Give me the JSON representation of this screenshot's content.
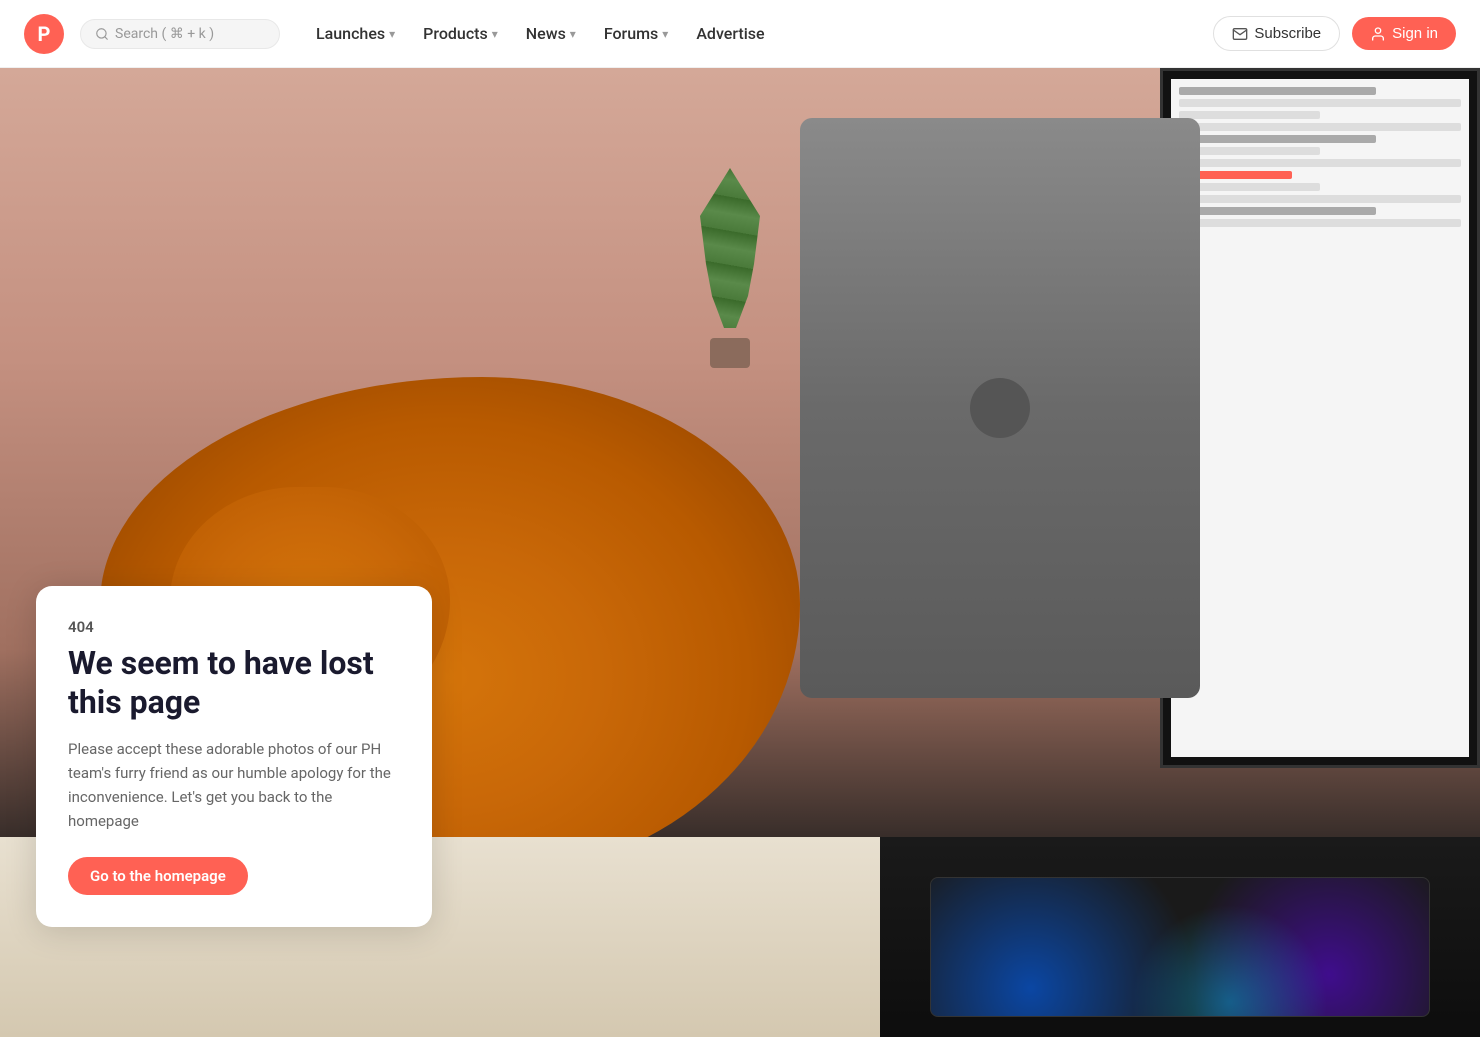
{
  "brand": {
    "logo_letter": "P",
    "logo_color": "#ff6154"
  },
  "nav": {
    "search_placeholder": "Search ( ⌘ + k )",
    "links": [
      {
        "id": "launches",
        "label": "Launches",
        "has_dropdown": true
      },
      {
        "id": "products",
        "label": "Products",
        "has_dropdown": true
      },
      {
        "id": "news",
        "label": "News",
        "has_dropdown": true
      },
      {
        "id": "forums",
        "label": "Forums",
        "has_dropdown": true
      },
      {
        "id": "advertise",
        "label": "Advertise",
        "has_dropdown": false
      }
    ],
    "subscribe_label": "Subscribe",
    "signin_label": "Sign in"
  },
  "error": {
    "code": "404",
    "title": "We seem to have lost this page",
    "description": "Please accept these adorable photos of our PH team's furry friend as our humble apology for the inconvenience. Let's get you back to the homepage",
    "cta_label": "Go to the homepage"
  }
}
